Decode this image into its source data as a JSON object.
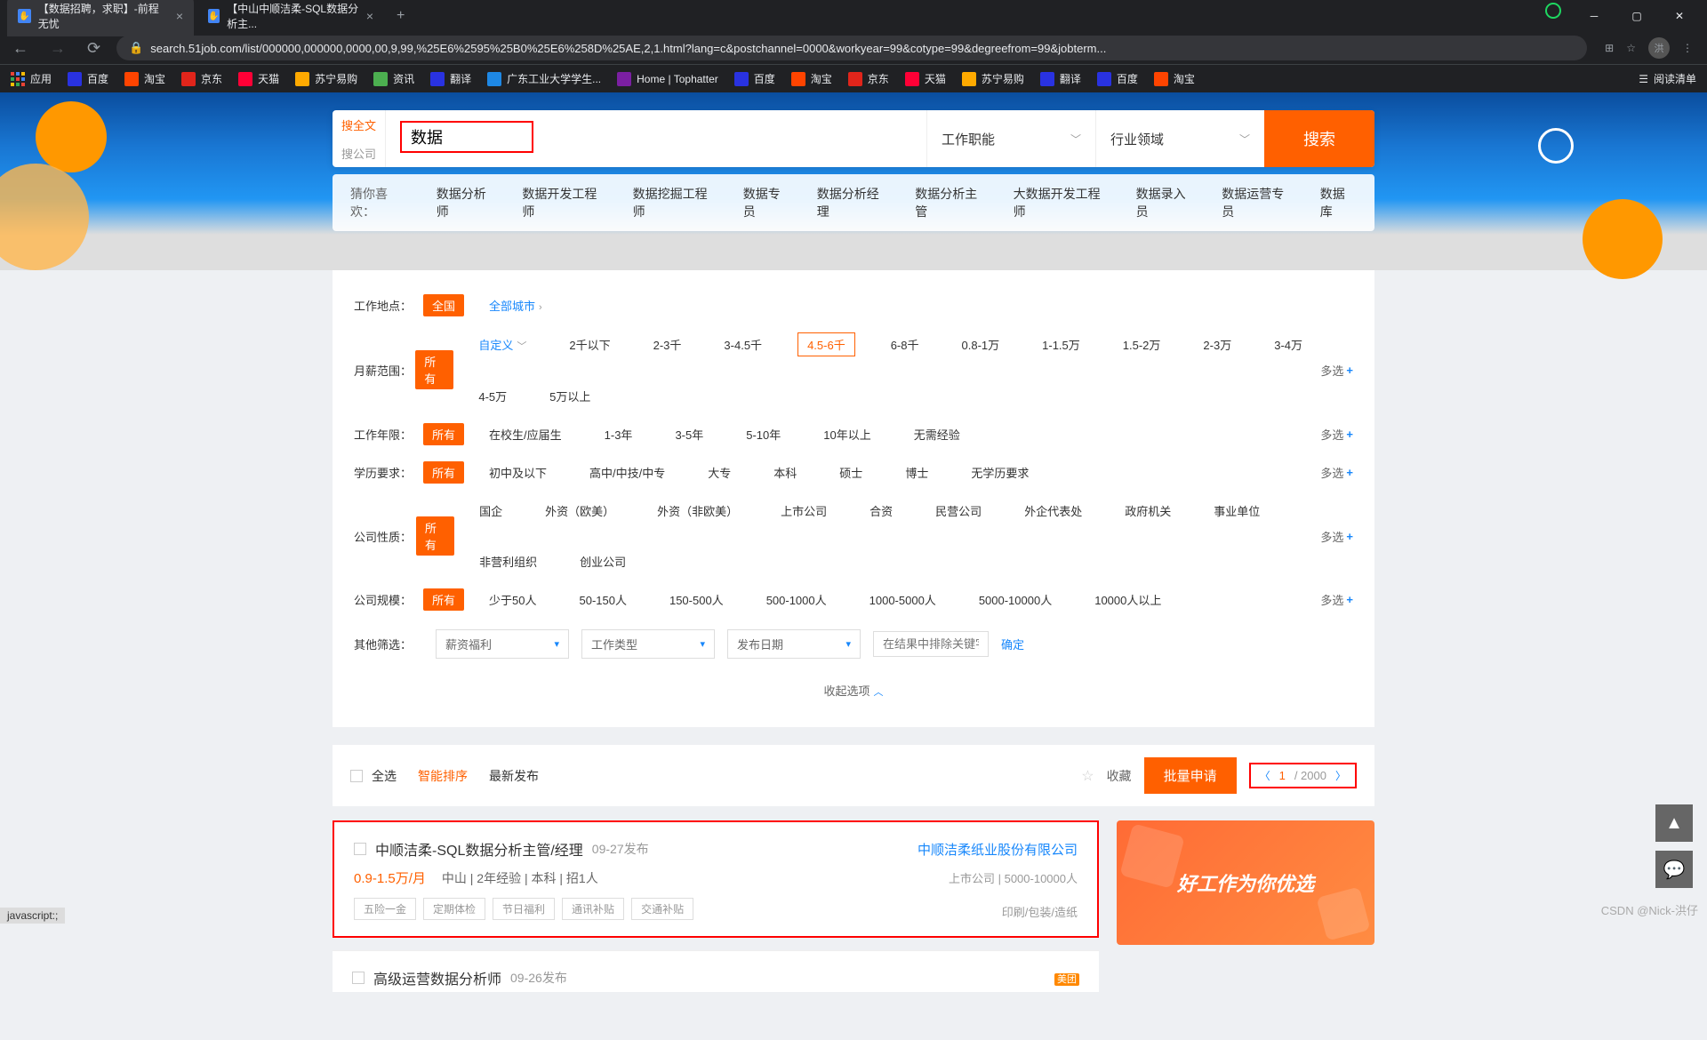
{
  "browser": {
    "tabs": [
      {
        "title": "【数据招聘，求职】-前程无忧"
      },
      {
        "title": "【中山中顺洁柔-SQL数据分析主..."
      }
    ],
    "url": "search.51job.com/list/000000,000000,0000,00,9,99,%25E6%2595%25B0%25E6%258D%25AE,2,1.html?lang=c&postchannel=0000&workyear=99&cotype=99&degreefrom=99&jobterm...",
    "avatar": "洪",
    "bookmarks": {
      "apps": "应用",
      "baidu1": "百度",
      "taobao1": "淘宝",
      "jd1": "京东",
      "tmall1": "天猫",
      "suning1": "苏宁易购",
      "zixun": "资讯",
      "fanyi1": "翻译",
      "gdut": "广东工业大学学生...",
      "tophatter": "Home | Tophatter",
      "baidu2": "百度",
      "taobao2": "淘宝",
      "jd2": "京东",
      "tmall2": "天猫",
      "suning2": "苏宁易购",
      "fanyi2": "翻译",
      "baidu3": "百度",
      "taobao3": "淘宝"
    },
    "readlist": "阅读清单"
  },
  "search": {
    "tab_full": "搜全文",
    "tab_company": "搜公司",
    "keyword": "数据",
    "job_function": "工作职能",
    "industry": "行业领域",
    "button": "搜索"
  },
  "suggest": {
    "label": "猜你喜欢：",
    "items": [
      "数据分析师",
      "数据开发工程师",
      "数据挖掘工程师",
      "数据专员",
      "数据分析经理",
      "数据分析主管",
      "大数据开发工程师",
      "数据录入员",
      "数据运营专员",
      "数据库"
    ]
  },
  "filters": {
    "location": {
      "label": "工作地点：",
      "all": "全国",
      "city": "全部城市"
    },
    "salary": {
      "label": "月薪范围：",
      "all": "所有",
      "custom": "自定义",
      "opts": [
        "2千以下",
        "2-3千",
        "3-4.5千",
        "4.5-6千",
        "6-8千",
        "0.8-1万",
        "1-1.5万",
        "1.5-2万",
        "2-3万",
        "3-4万",
        "4-5万",
        "5万以上"
      ],
      "highlight": "4.5-6千"
    },
    "workyear": {
      "label": "工作年限：",
      "all": "所有",
      "opts": [
        "在校生/应届生",
        "1-3年",
        "3-5年",
        "5-10年",
        "10年以上",
        "无需经验"
      ]
    },
    "degree": {
      "label": "学历要求：",
      "all": "所有",
      "opts": [
        "初中及以下",
        "高中/中技/中专",
        "大专",
        "本科",
        "硕士",
        "博士",
        "无学历要求"
      ]
    },
    "cotype": {
      "label": "公司性质：",
      "all": "所有",
      "opts": [
        "国企",
        "外资（欧美）",
        "外资（非欧美）",
        "上市公司",
        "合资",
        "民营公司",
        "外企代表处",
        "政府机关",
        "事业单位",
        "非营利组织",
        "创业公司"
      ]
    },
    "cosize": {
      "label": "公司规模：",
      "all": "所有",
      "opts": [
        "少于50人",
        "50-150人",
        "150-500人",
        "500-1000人",
        "1000-5000人",
        "5000-10000人",
        "10000人以上"
      ]
    },
    "other": {
      "label": "其他筛选：",
      "welfare": "薪资福利",
      "worktype": "工作类型",
      "pubdate": "发布日期",
      "exclude_ph": "在结果中排除关键字",
      "confirm": "确定"
    },
    "multi": "多选",
    "collapse": "收起选项"
  },
  "toolbar": {
    "select_all": "全选",
    "smart_sort": "智能排序",
    "latest": "最新发布",
    "favorite": "收藏",
    "batch_apply": "批量申请",
    "page": "1",
    "total": "/ 2000"
  },
  "jobs": [
    {
      "title": "中顺洁柔-SQL数据分析主管/经理",
      "date": "09-27发布",
      "company": "中顺洁柔纸业股份有限公司",
      "salary": "0.9-1.5万/月",
      "meta": "中山 | 2年经验 | 本科 | 招1人",
      "comp_meta": "上市公司 | 5000-10000人",
      "comp_type": "印刷/包装/造纸",
      "tags": [
        "五险一金",
        "定期体检",
        "节日福利",
        "通讯补贴",
        "交通补贴"
      ]
    },
    {
      "title": "高级运营数据分析师",
      "date": "09-26发布",
      "tuan": "美团"
    }
  ],
  "side_ad": "好工作为你优选",
  "status": "javascript:;",
  "watermark": "CSDN @Nick-洪仔"
}
